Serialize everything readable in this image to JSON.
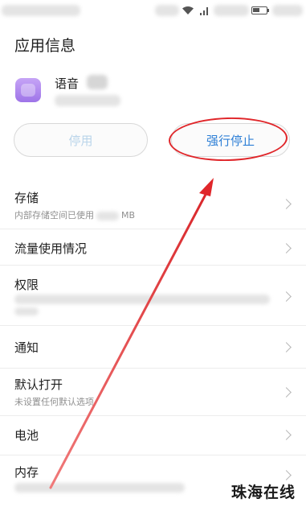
{
  "header": {
    "title": "应用信息"
  },
  "app": {
    "name": "语音"
  },
  "buttons": {
    "disable_label": "停用",
    "force_stop_label": "强行停止"
  },
  "rows": [
    {
      "title": "存储",
      "subtitle_prefix": "内部存储空间已使用",
      "subtitle_suffix": "MB"
    },
    {
      "title": "流量使用情况"
    },
    {
      "title": "权限"
    },
    {
      "title": "通知"
    },
    {
      "title": "默认打开",
      "subtitle": "未设置任何默认选项"
    },
    {
      "title": "电池"
    },
    {
      "title": "内存"
    }
  ],
  "annotation": {
    "color": "#e0262a"
  },
  "watermark": "珠海在线"
}
